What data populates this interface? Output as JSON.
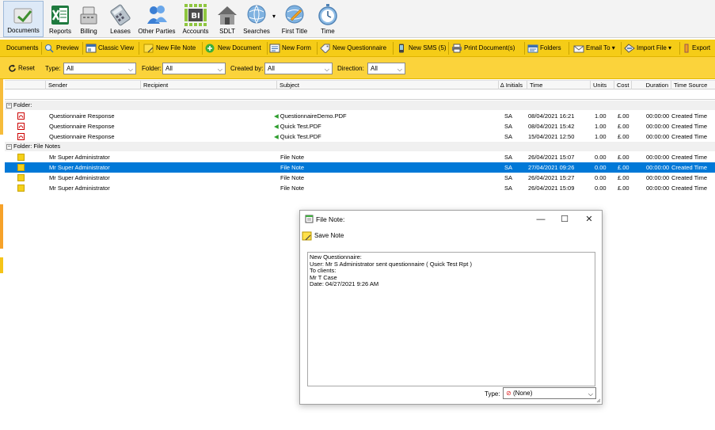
{
  "ribbon": [
    {
      "label": "Documents",
      "icon": "documents-icon",
      "active": true
    },
    {
      "label": "Reports",
      "icon": "excel-icon"
    },
    {
      "label": "Billing",
      "icon": "cash-register-icon"
    },
    {
      "label": "Leases",
      "icon": "calculator-icon"
    },
    {
      "label": "Other Parties",
      "icon": "people-icon"
    },
    {
      "label": "Accounts",
      "icon": "bi-icon"
    },
    {
      "label": "SDLT",
      "icon": "house-icon"
    },
    {
      "label": "Searches",
      "icon": "globe-search-icon"
    },
    {
      "label": "First Title",
      "icon": "globe-pen-icon"
    },
    {
      "label": "Time",
      "icon": "stopwatch-icon"
    }
  ],
  "toolbar": {
    "documents": "Documents",
    "preview": "Preview",
    "classic_view": "Classic View",
    "new_file_note": "New File Note",
    "new_document": "New Document",
    "new_form": "New Form",
    "new_questionnaire": "New Questionnaire",
    "new_sms": "New SMS (5)",
    "print_documents": "Print Document(s)",
    "folders": "Folders",
    "email_to": "Email To",
    "import_file": "Import File",
    "export": "Export"
  },
  "filters": {
    "reset": "Reset",
    "type_label": "Type:",
    "type_value": "All",
    "folder_label": "Folder:",
    "folder_value": "All",
    "created_by_label": "Created by:",
    "created_by_value": "All",
    "direction_label": "Direction:",
    "direction_value": "All"
  },
  "columns": {
    "sender": "Sender",
    "recipient": "Recipient",
    "subject": "Subject",
    "initials": "Initials",
    "time": "Time",
    "units": "Units",
    "cost": "Cost",
    "duration": "Duration",
    "time_source": "Time Source"
  },
  "groups": [
    {
      "label": "Folder:",
      "rows": [
        {
          "sender": "Questionnaire Response",
          "subject": "QuestionnaireDemo.PDF",
          "initials": "SA",
          "time": "08/04/2021 16:21",
          "units": "1.00",
          "cost": "£.00",
          "duration": "00:00:00",
          "source": "Created Time"
        },
        {
          "sender": "Questionnaire Response",
          "subject": "Quick Test.PDF",
          "initials": "SA",
          "time": "08/04/2021 15:42",
          "units": "1.00",
          "cost": "£.00",
          "duration": "00:00:00",
          "source": "Created Time"
        },
        {
          "sender": "Questionnaire Response",
          "subject": "Quick Test.PDF",
          "initials": "SA",
          "time": "15/04/2021 12:50",
          "units": "1.00",
          "cost": "£.00",
          "duration": "00:00:00",
          "source": "Created Time"
        }
      ]
    },
    {
      "label": "Folder: File Notes",
      "rows": [
        {
          "sender": "Mr Super Administrator",
          "subject": "File Note",
          "initials": "SA",
          "time": "26/04/2021 15:07",
          "units": "0.00",
          "cost": "£.00",
          "duration": "00:00:00",
          "source": "Created Time"
        },
        {
          "sender": "Mr Super Administrator",
          "subject": "File Note",
          "initials": "SA",
          "time": "27/04/2021 09:26",
          "units": "0.00",
          "cost": "£.00",
          "duration": "00:00:00",
          "source": "Created Time",
          "selected": true
        },
        {
          "sender": "Mr Super Administrator",
          "subject": "File Note",
          "initials": "SA",
          "time": "26/04/2021 15:27",
          "units": "0.00",
          "cost": "£.00",
          "duration": "00:00:00",
          "source": "Created Time"
        },
        {
          "sender": "Mr Super Administrator",
          "subject": "File Note",
          "initials": "SA",
          "time": "26/04/2021 15:09",
          "units": "0.00",
          "cost": "£.00",
          "duration": "00:00:00",
          "source": "Created Time"
        }
      ]
    }
  ],
  "dialog": {
    "title": "File Note:",
    "save_label": "Save Note",
    "lines": [
      "New Questionnaire:",
      "User: Mr S Administrator sent questionnaire ( Quick Test Rpt )",
      "To clients:",
      "Mr T Case",
      "Date: 04/27/2021 9:26 AM"
    ],
    "type_label": "Type:",
    "type_value": "(None)"
  },
  "colors": {
    "toolbar": "#f5cc17",
    "selection": "#0078d7"
  }
}
